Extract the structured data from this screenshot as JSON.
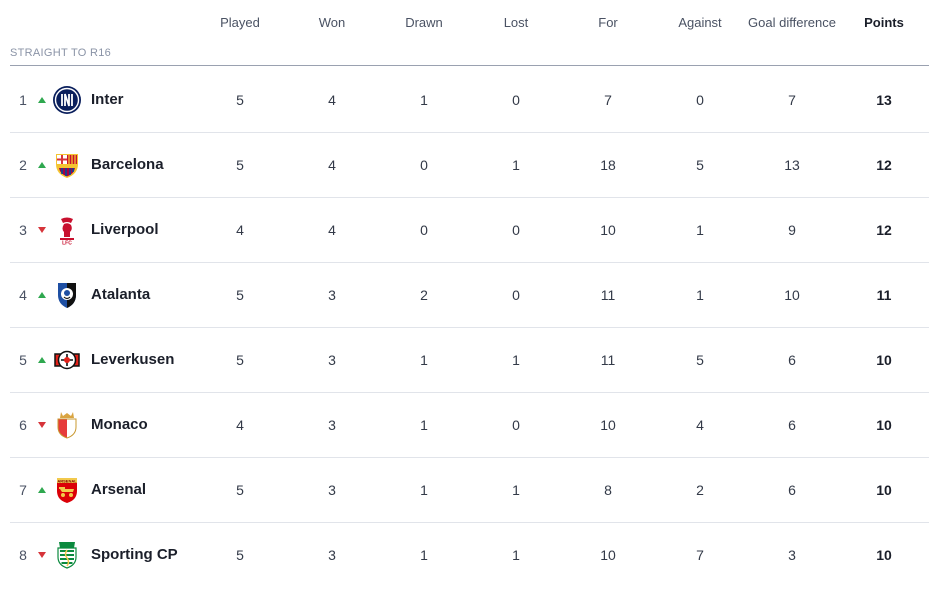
{
  "header": {
    "played": "Played",
    "won": "Won",
    "drawn": "Drawn",
    "lost": "Lost",
    "for": "For",
    "against": "Against",
    "goal_difference": "Goal difference",
    "points": "Points"
  },
  "section": {
    "label": "STRAIGHT TO R16"
  },
  "colors": {
    "trend_up": "#2fa84f",
    "trend_down": "#d6343a",
    "divider": "#e1e4ea"
  },
  "rows": [
    {
      "pos": "1",
      "trend": "up",
      "team": "Inter",
      "crest": "inter-crest-icon",
      "played": "5",
      "won": "4",
      "drawn": "1",
      "lost": "0",
      "for": "7",
      "against": "0",
      "gd": "7",
      "points": "13"
    },
    {
      "pos": "2",
      "trend": "up",
      "team": "Barcelona",
      "crest": "barcelona-crest-icon",
      "played": "5",
      "won": "4",
      "drawn": "0",
      "lost": "1",
      "for": "18",
      "against": "5",
      "gd": "13",
      "points": "12"
    },
    {
      "pos": "3",
      "trend": "down",
      "team": "Liverpool",
      "crest": "liverpool-crest-icon",
      "played": "4",
      "won": "4",
      "drawn": "0",
      "lost": "0",
      "for": "10",
      "against": "1",
      "gd": "9",
      "points": "12"
    },
    {
      "pos": "4",
      "trend": "up",
      "team": "Atalanta",
      "crest": "atalanta-crest-icon",
      "played": "5",
      "won": "3",
      "drawn": "2",
      "lost": "0",
      "for": "11",
      "against": "1",
      "gd": "10",
      "points": "11"
    },
    {
      "pos": "5",
      "trend": "up",
      "team": "Leverkusen",
      "crest": "leverkusen-crest-icon",
      "played": "5",
      "won": "3",
      "drawn": "1",
      "lost": "1",
      "for": "11",
      "against": "5",
      "gd": "6",
      "points": "10"
    },
    {
      "pos": "6",
      "trend": "down",
      "team": "Monaco",
      "crest": "monaco-crest-icon",
      "played": "4",
      "won": "3",
      "drawn": "1",
      "lost": "0",
      "for": "10",
      "against": "4",
      "gd": "6",
      "points": "10"
    },
    {
      "pos": "7",
      "trend": "up",
      "team": "Arsenal",
      "crest": "arsenal-crest-icon",
      "played": "5",
      "won": "3",
      "drawn": "1",
      "lost": "1",
      "for": "8",
      "against": "2",
      "gd": "6",
      "points": "10"
    },
    {
      "pos": "8",
      "trend": "down",
      "team": "Sporting CP",
      "crest": "sporting-crest-icon",
      "played": "5",
      "won": "3",
      "drawn": "1",
      "lost": "1",
      "for": "10",
      "against": "7",
      "gd": "3",
      "points": "10"
    }
  ]
}
